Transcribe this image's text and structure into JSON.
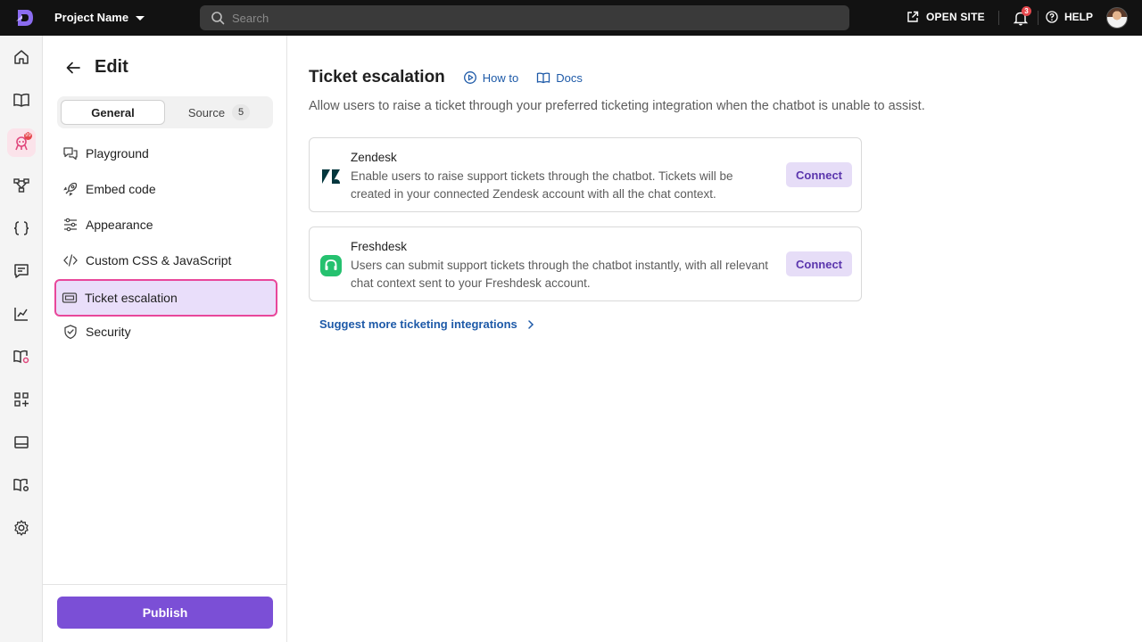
{
  "topbar": {
    "project_name": "Project Name",
    "search_placeholder": "Search",
    "open_site": "OPEN SITE",
    "notification_count": "3",
    "help": "HELP"
  },
  "rail": {
    "active_badge": "99",
    "items": [
      "home-icon",
      "book-icon",
      "chatbot-icon",
      "workflow-icon",
      "code-braces-icon",
      "chat-icon",
      "analytics-icon",
      "knowledge-icon",
      "apps-icon",
      "layout-icon",
      "docs-settings-icon",
      "settings-icon"
    ]
  },
  "side": {
    "title": "Edit",
    "tabs": {
      "general": "General",
      "source": "Source",
      "source_count": "5"
    },
    "nav": [
      {
        "label": "Playground",
        "icon": "chat-bubbles-icon"
      },
      {
        "label": "Embed code",
        "icon": "rocket-icon"
      },
      {
        "label": "Appearance",
        "icon": "sliders-icon"
      },
      {
        "label": "Custom CSS & JavaScript",
        "icon": "code-icon"
      },
      {
        "label": "Ticket escalation",
        "icon": "ticket-icon",
        "active": true
      },
      {
        "label": "Security",
        "icon": "shield-icon"
      }
    ],
    "publish": "Publish"
  },
  "main": {
    "title": "Ticket escalation",
    "how_to": "How to",
    "docs": "Docs",
    "description": "Allow users to raise a ticket through your preferred ticketing integration when the chatbot is unable to assist.",
    "integrations": [
      {
        "name": "Zendesk",
        "text": "Enable users to raise support tickets through the chatbot. Tickets will be created in your connected Zendesk account with all the chat context.",
        "action": "Connect"
      },
      {
        "name": "Freshdesk",
        "text": "Users can submit support tickets through the chatbot instantly, with all relevant chat context sent to your Freshdesk account.",
        "action": "Connect"
      }
    ],
    "suggest": "Suggest more ticketing integrations"
  },
  "colors": {
    "accent": "#7b4fd6",
    "link": "#1e5aa8",
    "highlight_outline": "#e8479a",
    "active_bg": "#e9defa"
  }
}
